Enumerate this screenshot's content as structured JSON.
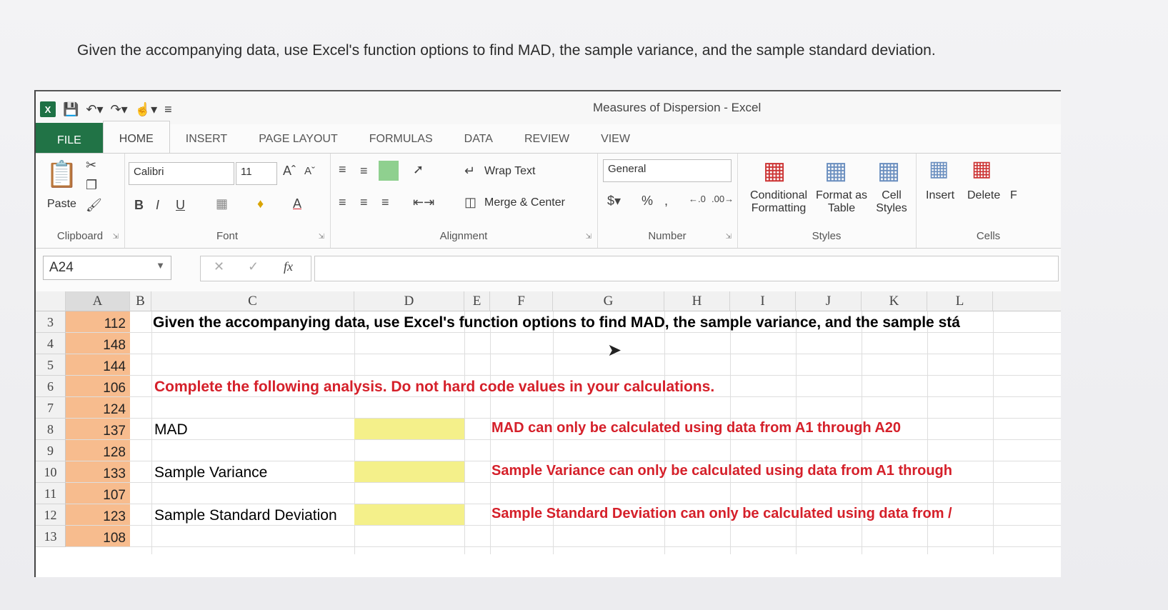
{
  "question": "Given the accompanying data, use Excel's function options to find MAD, the sample variance, and the sample standard deviation.",
  "window": {
    "title": "Measures of Dispersion - Excel"
  },
  "tabs": [
    "FILE",
    "HOME",
    "INSERT",
    "PAGE LAYOUT",
    "FORMULAS",
    "DATA",
    "REVIEW",
    "VIEW"
  ],
  "active_tab": "HOME",
  "ribbon": {
    "clipboard": {
      "label": "Clipboard",
      "paste": "Paste"
    },
    "font": {
      "label": "Font",
      "name": "Calibri",
      "size": "11"
    },
    "alignment": {
      "label": "Alignment",
      "wrap": "Wrap Text",
      "merge": "Merge & Center"
    },
    "number": {
      "label": "Number",
      "format": "General"
    },
    "styles": {
      "label": "Styles",
      "conditional_1": "Conditional",
      "conditional_2": "Formatting",
      "format_table_1": "Format as",
      "format_table_2": "Table",
      "cell_styles_1": "Cell",
      "cell_styles_2": "Styles"
    },
    "cells": {
      "label": "Cells",
      "insert": "Insert",
      "delete": "Delete",
      "format": "F"
    }
  },
  "formula_bar": {
    "name_box": "A24",
    "fx": "fx",
    "value": ""
  },
  "columns": [
    "A",
    "B",
    "C",
    "D",
    "E",
    "F",
    "G",
    "H",
    "I",
    "J",
    "K",
    "L"
  ],
  "rows": [
    {
      "num": "3",
      "a": "112"
    },
    {
      "num": "4",
      "a": "148"
    },
    {
      "num": "5",
      "a": "144"
    },
    {
      "num": "6",
      "a": "106"
    },
    {
      "num": "7",
      "a": "124"
    },
    {
      "num": "8",
      "a": "137"
    },
    {
      "num": "9",
      "a": "128"
    },
    {
      "num": "10",
      "a": "133"
    },
    {
      "num": "11",
      "a": "107"
    },
    {
      "num": "12",
      "a": "123"
    },
    {
      "num": "13",
      "a": "108"
    }
  ],
  "sheet_text": {
    "c3": "Given the accompanying data, use Excel's function options to find MAD, the sample variance, and the sample stá",
    "c6": "Complete the following analysis. Do not hard code values in your calculations.",
    "c8": "MAD",
    "c10": "Sample Variance",
    "c12": "Sample Standard Deviation",
    "f8": "MAD can only be calculated using data from A1 through A20",
    "f10": "Sample Variance can only be calculated using data from A1 through",
    "f12": "Sample Standard Deviation can only be calculated using data from /"
  },
  "colors": {
    "file_tab": "#217346",
    "data_cells": "#f7bc8e",
    "answer_cells": "#f4f08a",
    "red_text": "#d5202a"
  }
}
